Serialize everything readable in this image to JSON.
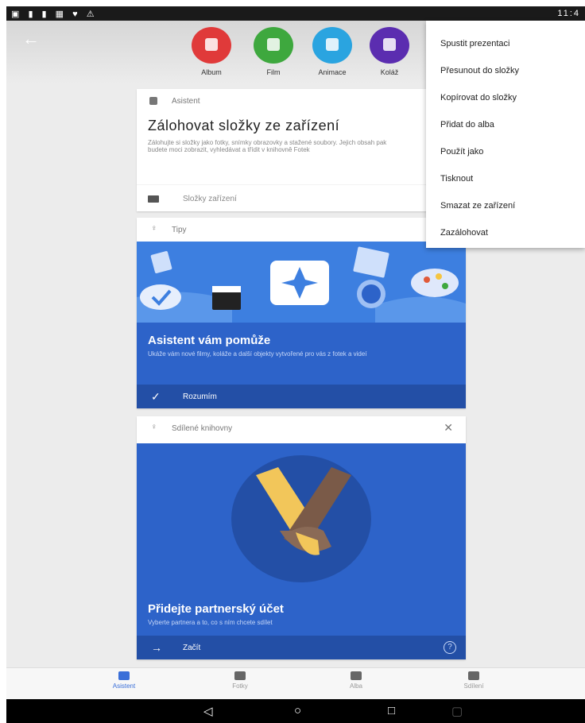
{
  "status_bar": {
    "left": "▣ ▮ ▮ ▦ ♥ ⚠",
    "time": "11:4"
  },
  "create_row": [
    {
      "label": "Album",
      "color": "#e03a3a"
    },
    {
      "label": "Film",
      "color": "#3ea83e"
    },
    {
      "label": "Animace",
      "color": "#2aa4e0"
    },
    {
      "label": "Koláž",
      "color": "#5b2db0"
    }
  ],
  "backup_card": {
    "header": "Asistent",
    "title": "Zálohovat složky ze zařízení",
    "description": "Zálohujte si složky jako fotky, snímky obrazovky a stažené soubory. Jejich obsah pak budete moci zobrazit, vyhledávat a třídit v knihovně Fotek",
    "footer": "Složky zařízení"
  },
  "tips_card": {
    "header": "Tipy",
    "title": "Asistent vám pomůže",
    "description": "Ukáže vám nové filmy, koláže a další objekty vytvořené pro vás z fotek a videí",
    "action": "Rozumím"
  },
  "sharing_card": {
    "header": "Sdílené knihovny",
    "title": "Přidejte partnerský účet",
    "description": "Vyberte partnera a to, co s ním chcete sdílet",
    "action": "Začít"
  },
  "menu": [
    "Spustit prezentaci",
    "Přesunout do složky",
    "Kopírovat do složky",
    "Přidat do alba",
    "Použít jako",
    "Tisknout",
    "Smazat ze zařízení",
    "Zazálohovat"
  ],
  "bottom_nav": [
    {
      "label": "Asistent",
      "active": true
    },
    {
      "label": "Fotky",
      "active": false
    },
    {
      "label": "Alba",
      "active": false
    },
    {
      "label": "Sdílení",
      "active": false
    }
  ],
  "colors": {
    "accent": "#3a6fd8",
    "card_blue": "#2d63c9",
    "illustration_blue": "#3d7fe0"
  }
}
